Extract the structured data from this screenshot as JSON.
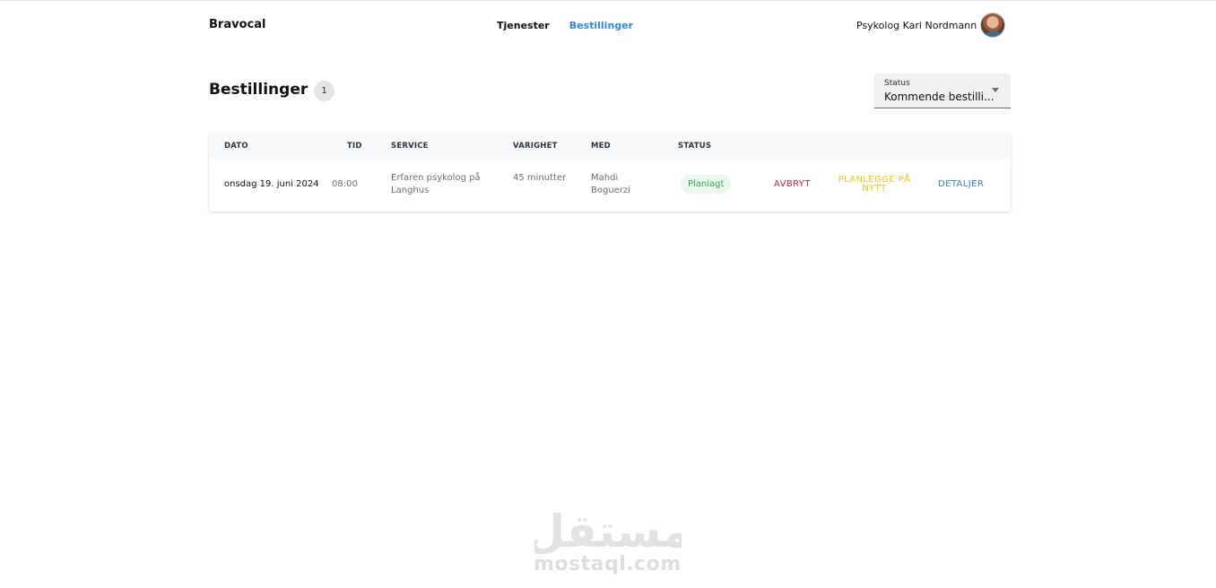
{
  "header": {
    "brand": "Bravocal",
    "nav": [
      {
        "label": "Tjenester",
        "active": false
      },
      {
        "label": "Bestillinger",
        "active": true
      }
    ],
    "user_name": "Psykolog Kari Nordmann",
    "avatar_icon": "avatar-photo"
  },
  "main": {
    "title": "Bestillinger",
    "count": "1",
    "status_filter": {
      "label": "Status",
      "value": "Kommende bestilli..."
    }
  },
  "table": {
    "columns": [
      "DATO",
      "TID",
      "SERVICE",
      "VARIGHET",
      "MED",
      "STATUS"
    ],
    "rows": [
      {
        "dato": "onsdag 19. juni 2024",
        "tid": "08:00",
        "service": "Erfaren psykolog på Langhus",
        "varighet": "45 minutter",
        "med": "Mahdi Boguerzi",
        "status": "Planlagt",
        "actions": {
          "cancel": "AVBRYT",
          "reschedule": "PLANLEGGE PÅ NYTT",
          "details": "DETALJER"
        }
      }
    ]
  },
  "watermark": {
    "arabic": "مستقل",
    "latin": "mostaql.com"
  },
  "colors": {
    "accent": "#2f8ae0",
    "cancel": "#c1272d",
    "reschedule": "#efc31a",
    "details": "#2f7fd4",
    "status_bg": "#e9f7ec",
    "status_text": "#3aa552"
  }
}
